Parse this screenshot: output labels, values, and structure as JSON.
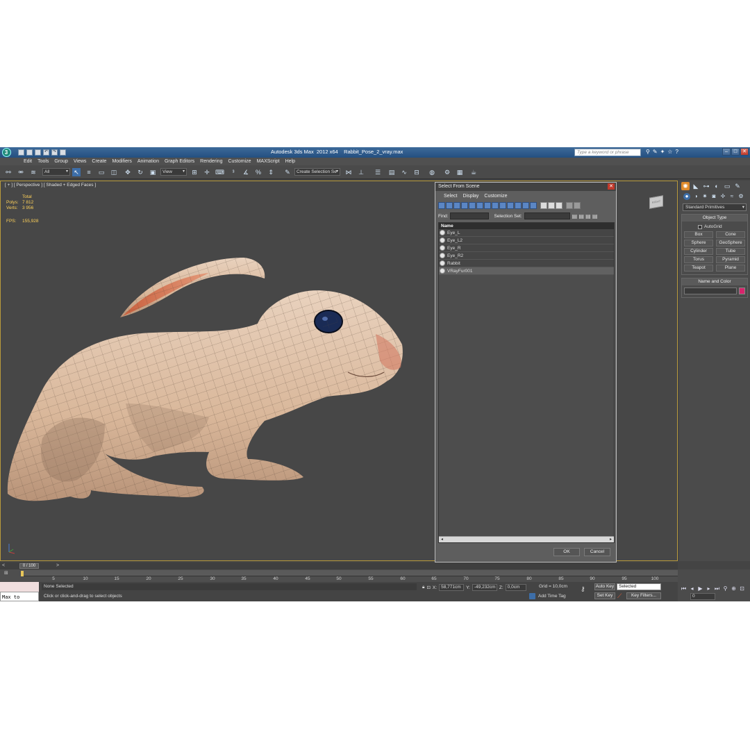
{
  "titlebar": {
    "app_title": "Autodesk 3ds Max  2012 x64",
    "file_name": "Rabbit_Pose_2_vray.max",
    "search_placeholder": "Type a keyword or phrase"
  },
  "menu": [
    "Edit",
    "Tools",
    "Group",
    "Views",
    "Create",
    "Modifiers",
    "Animation",
    "Graph Editors",
    "Rendering",
    "Customize",
    "MAXScript",
    "Help"
  ],
  "toolbar": {
    "selection_filter": "All",
    "reference_coord": "View",
    "named_selection": "Create Selection Se"
  },
  "viewport": {
    "label": "[ + ] [ Perspective ] [ Shaded + Edged Faces ]",
    "stats": {
      "total_label": "Total",
      "polys_label": "Polys:",
      "polys_value": "7 812",
      "verts_label": "Verts:",
      "verts_value": "3 956",
      "fps_label": "FPS:",
      "fps_value": "155,928"
    },
    "viewcube_label": "RIGHT"
  },
  "dialog": {
    "title": "Select From Scene",
    "menu": [
      "Select",
      "Display",
      "Customize"
    ],
    "find_label": "Find:",
    "selection_set_label": "Selection Set:",
    "column_header": "Name",
    "items": [
      "Eye_L",
      "Eye_L2",
      "Eye_R",
      "Eye_R2",
      "Rabbit",
      "VRayFur001"
    ],
    "ok": "OK",
    "cancel": "Cancel"
  },
  "command_panel": {
    "category": "Standard Primitives",
    "object_type_title": "Object Type",
    "autogrid": "AutoGrid",
    "primitives": [
      "Box",
      "Cone",
      "Sphere",
      "GeoSphere",
      "Cylinder",
      "Tube",
      "Torus",
      "Pyramid",
      "Teapot",
      "Plane"
    ],
    "name_color_title": "Name and Color",
    "color": "#d8246c"
  },
  "timeline": {
    "slider": "0 / 100",
    "ticks": [
      "5",
      "10",
      "15",
      "20",
      "25",
      "30",
      "35",
      "40",
      "45",
      "50",
      "55",
      "60",
      "65",
      "70",
      "75",
      "80",
      "85",
      "90",
      "95",
      "100"
    ]
  },
  "status": {
    "listener": "Max to Physc.",
    "selection": "None Selected",
    "prompt": "Click or click-and-drag to select objects",
    "x_label": "X:",
    "x_value": "58,771cm",
    "y_label": "Y:",
    "y_value": "-49,232cm",
    "z_label": "Z:",
    "z_value": "0,0cm",
    "grid": "Grid = 10,0cm",
    "add_time_tag": "Add Time Tag",
    "auto_key": "Auto Key",
    "auto_key_mode": "Selected",
    "set_key": "Set Key",
    "key_filters": "Key Filters...",
    "frame": "0"
  }
}
